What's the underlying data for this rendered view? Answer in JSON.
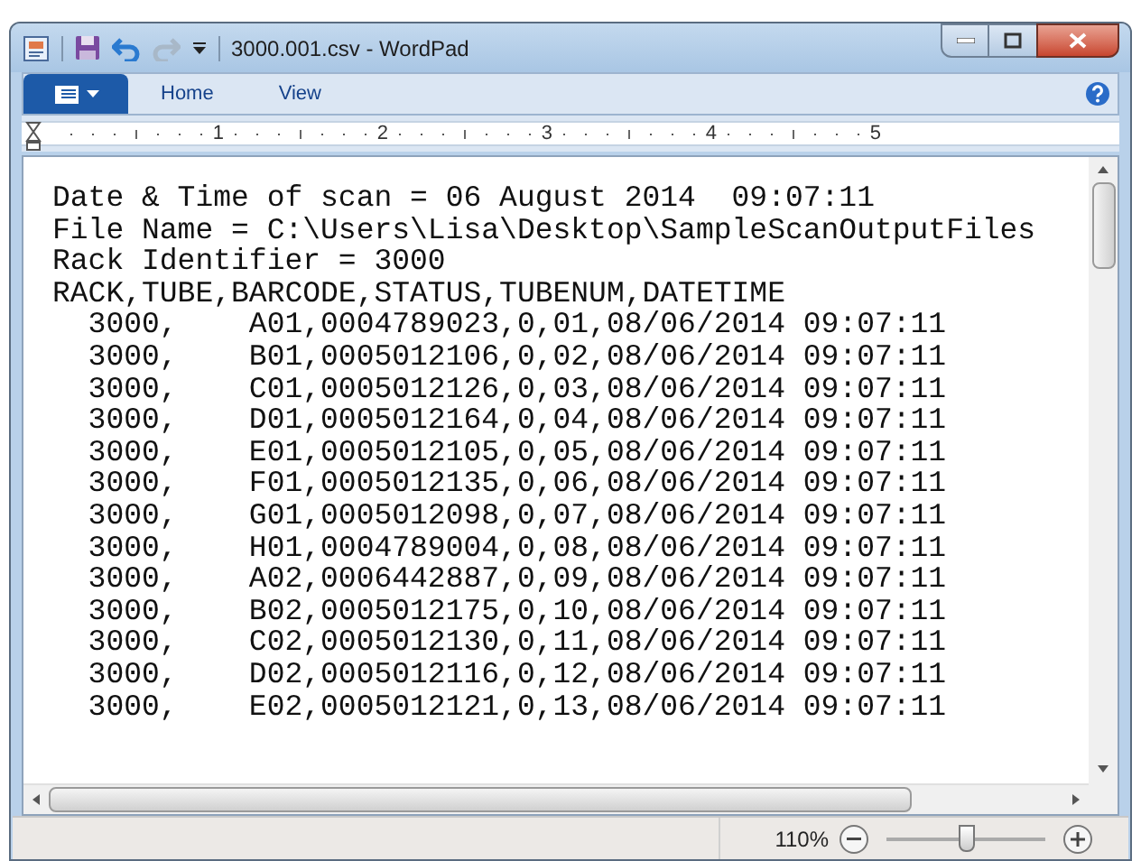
{
  "window": {
    "title": "3000.001.csv - WordPad"
  },
  "ribbon": {
    "tabs": [
      {
        "label": "Home",
        "selected": false
      },
      {
        "label": "View",
        "selected": false
      }
    ]
  },
  "ruler": {
    "numbers": [
      "1",
      "2",
      "3",
      "4",
      "5"
    ]
  },
  "document": {
    "lines": [
      "Date & Time of scan = 06 August 2014  09:07:11",
      "File Name = C:\\Users\\Lisa\\Desktop\\SampleScanOutputFiles",
      "Rack Identifier = 3000",
      "RACK,TUBE,BARCODE,STATUS,TUBENUM,DATETIME",
      "  3000,    A01,0004789023,0,01,08/06/2014 09:07:11",
      "  3000,    B01,0005012106,0,02,08/06/2014 09:07:11",
      "  3000,    C01,0005012126,0,03,08/06/2014 09:07:11",
      "  3000,    D01,0005012164,0,04,08/06/2014 09:07:11",
      "  3000,    E01,0005012105,0,05,08/06/2014 09:07:11",
      "  3000,    F01,0005012135,0,06,08/06/2014 09:07:11",
      "  3000,    G01,0005012098,0,07,08/06/2014 09:07:11",
      "  3000,    H01,0004789004,0,08,08/06/2014 09:07:11",
      "  3000,    A02,0006442887,0,09,08/06/2014 09:07:11",
      "  3000,    B02,0005012175,0,10,08/06/2014 09:07:11",
      "  3000,    C02,0005012130,0,11,08/06/2014 09:07:11",
      "  3000,    D02,0005012116,0,12,08/06/2014 09:07:11",
      "  3000,    E02,0005012121,0,13,08/06/2014 09:07:11"
    ]
  },
  "status_bar": {
    "zoom": "110%",
    "zoom_slider": {
      "level": 0.5
    }
  }
}
